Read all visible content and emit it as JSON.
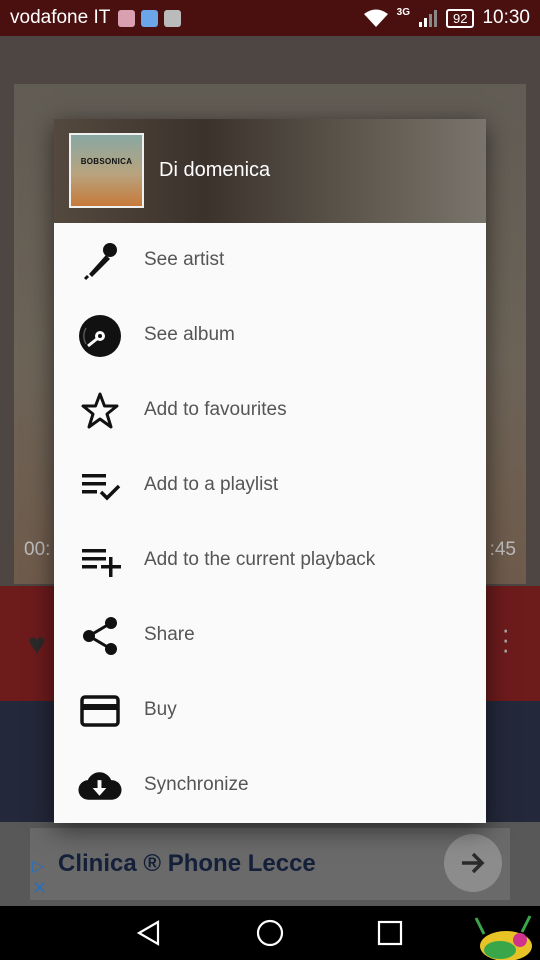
{
  "status_bar": {
    "carrier": "vodafone IT",
    "network": "3G",
    "battery": "92",
    "time": "10:30"
  },
  "background": {
    "time_left": "00:",
    "time_right": ":45"
  },
  "dialog": {
    "title": "Di domenica",
    "album_text": "BOBSONICA",
    "menu": [
      {
        "label": "See artist",
        "icon": "microphone-icon"
      },
      {
        "label": "See album",
        "icon": "album-icon"
      },
      {
        "label": "Add to favourites",
        "icon": "star-icon"
      },
      {
        "label": "Add to a playlist",
        "icon": "playlist-add-check-icon"
      },
      {
        "label": "Add to the current playback",
        "icon": "playlist-add-icon"
      },
      {
        "label": "Share",
        "icon": "share-icon"
      },
      {
        "label": "Buy",
        "icon": "credit-card-icon"
      },
      {
        "label": "Synchronize",
        "icon": "cloud-download-icon"
      }
    ]
  },
  "ad": {
    "text": "Clinica ® Phone Lecce"
  },
  "colors": {
    "status_bar": "#4a1010",
    "dialog_bg": "#fafafa",
    "menu_text": "#555555",
    "icon": "#111111"
  }
}
